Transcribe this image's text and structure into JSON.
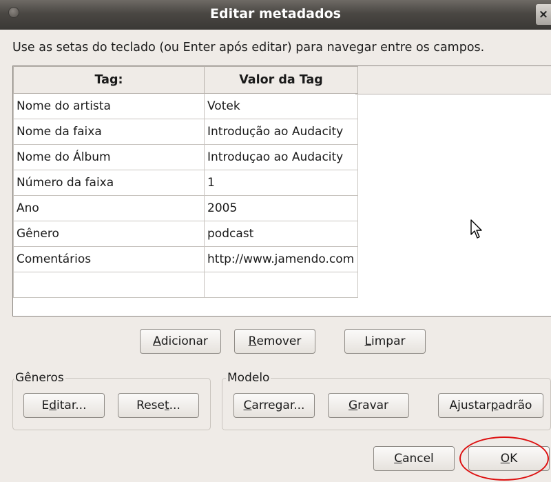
{
  "window": {
    "title": "Editar metadados",
    "close_glyph": "×"
  },
  "instruction": "Use as setas do teclado (ou Enter após editar) para navegar entre os campos.",
  "table": {
    "headers": [
      "Tag:",
      "Valor da Tag"
    ],
    "rows": [
      [
        "Nome do artista",
        "Votek"
      ],
      [
        "Nome da faixa",
        "Introdução ao Audacity"
      ],
      [
        "Nome do Álbum",
        "Introduçao ao Audacity"
      ],
      [
        "Número da faixa",
        "1"
      ],
      [
        "Ano",
        "2005"
      ],
      [
        "Gênero",
        "podcast"
      ],
      [
        "Comentários",
        "http://www.jamendo.com"
      ],
      [
        "",
        ""
      ]
    ]
  },
  "buttons": {
    "adicionar": {
      "pre": "",
      "key": "A",
      "post": "dicionar"
    },
    "remover": {
      "pre": "",
      "key": "R",
      "post": "emover"
    },
    "limpar": {
      "pre": "",
      "key": "L",
      "post": "impar"
    },
    "editar": {
      "pre": "E",
      "key": "d",
      "post": "itar..."
    },
    "reset": {
      "pre": "Rese",
      "key": "t",
      "post": "..."
    },
    "carregar": {
      "pre": "",
      "key": "C",
      "post": "arregar..."
    },
    "gravar": {
      "pre": "",
      "key": "G",
      "post": "ravar"
    },
    "ajustar": {
      "pre": "Ajustar ",
      "key": "p",
      "post": "adrão"
    },
    "cancel": {
      "pre": "",
      "key": "C",
      "post": "ancel"
    },
    "ok": {
      "pre": "",
      "key": "O",
      "post": "K"
    }
  },
  "groups": {
    "generos": "Gêneros",
    "modelo": "Modelo"
  },
  "annotation": {
    "highlight_color": "#dd1111",
    "highlighted": "ok-button"
  }
}
